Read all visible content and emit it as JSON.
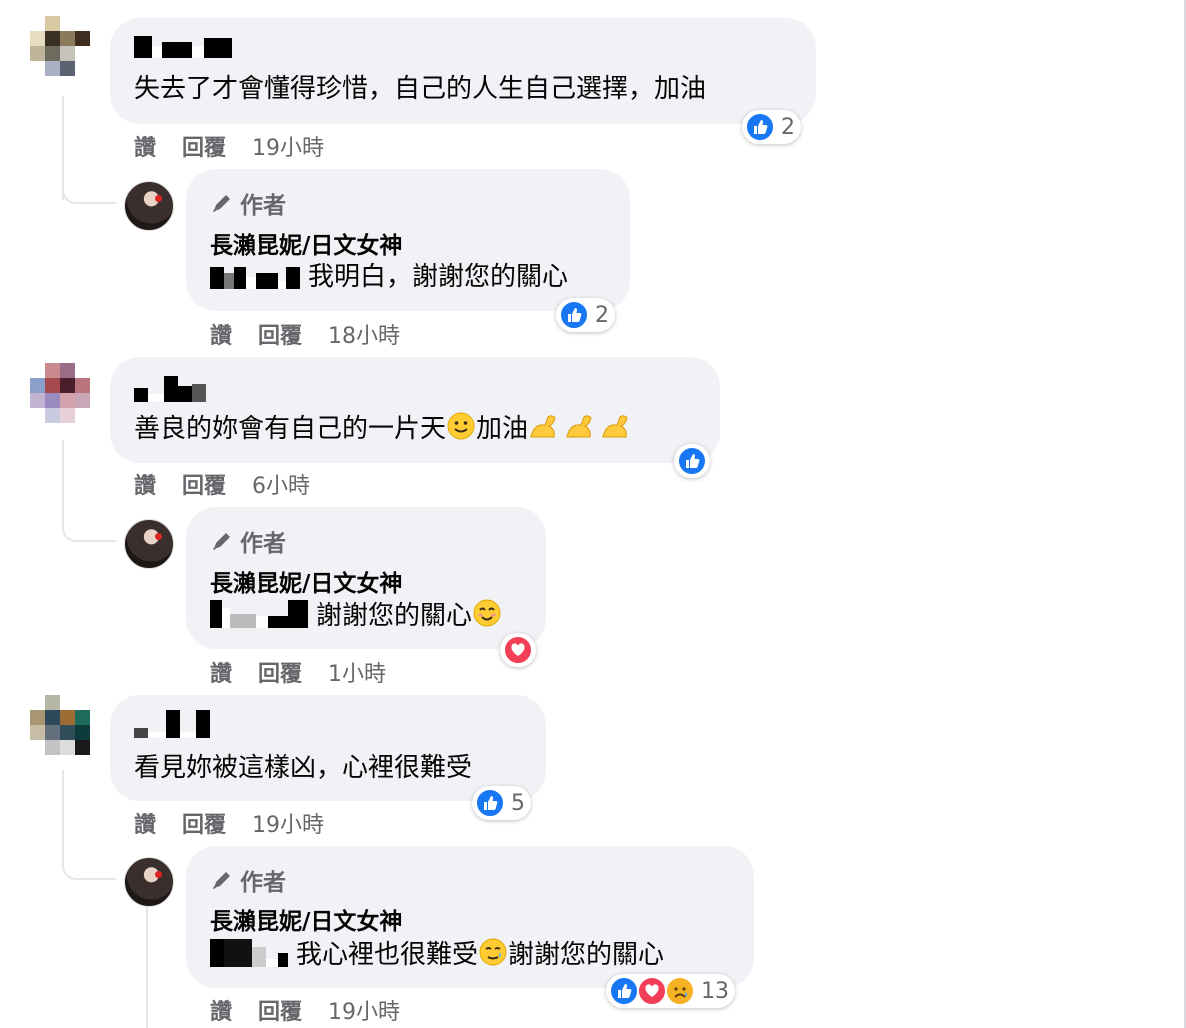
{
  "colors": {
    "like": "#1877f2",
    "love": "#f33e58",
    "sad": "#f7b125",
    "meta": "#65676b",
    "bubble": "#f0f2f5"
  },
  "labels": {
    "like": "讚",
    "reply": "回覆",
    "author": "作者"
  },
  "comments": [
    {
      "text": "失去了才會懂得珍惜，自己的人生自己選擇，加油",
      "time": "19小時",
      "reactions": {
        "icons": [
          "like-icon"
        ],
        "count": "2"
      },
      "reply": {
        "author_name": "長瀨昆妮/日文女神",
        "text": "我明白，謝謝您的關心",
        "time": "18小時",
        "reactions": {
          "icons": [
            "like-icon"
          ],
          "count": "2"
        }
      }
    },
    {
      "text": "善良的妳會有自己的一片天",
      "text_tail": "加油",
      "time": "6小時",
      "reactions": {
        "icons": [
          "like-icon"
        ],
        "count": ""
      },
      "reply": {
        "author_name": "長瀨昆妮/日文女神",
        "text": "謝謝您的關心",
        "time": "1小時",
        "reactions": {
          "icons": [
            "love-icon"
          ],
          "count": ""
        }
      }
    },
    {
      "text": "看見妳被這樣凶，心裡很難受",
      "time": "19小時",
      "reactions": {
        "icons": [
          "like-icon"
        ],
        "count": "5"
      },
      "reply": {
        "author_name": "長瀨昆妮/日文女神",
        "text": "我心裡也很難受",
        "text_tail": "謝謝您的關心",
        "time": "19小時",
        "reactions": {
          "icons": [
            "like-icon",
            "love-icon",
            "sad-icon"
          ],
          "count": "13"
        }
      }
    }
  ]
}
